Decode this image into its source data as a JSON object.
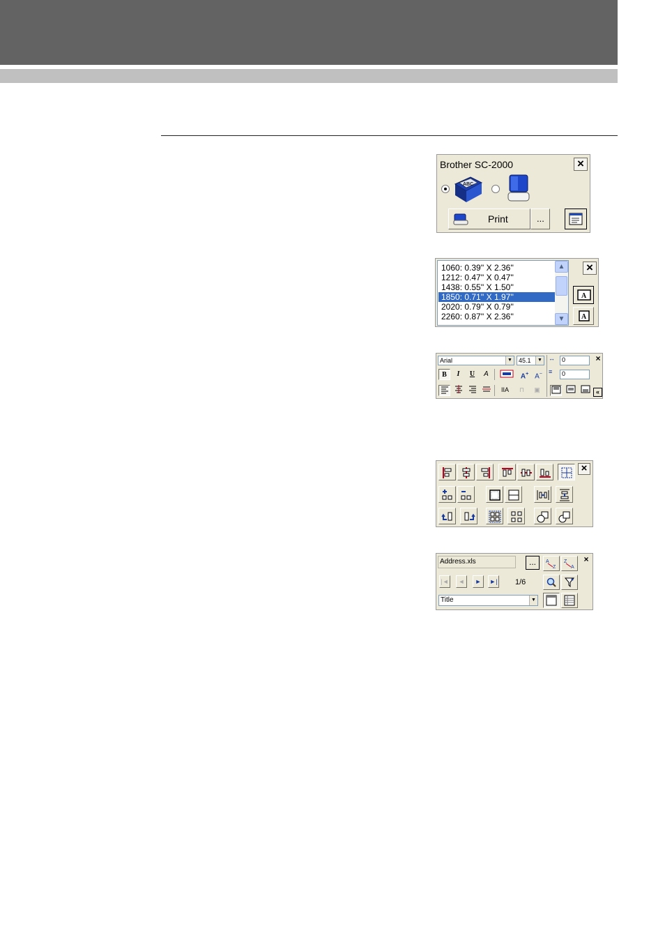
{
  "printer_panel": {
    "title": "Brother SC-2000",
    "print_label": "Print",
    "more_label": "..."
  },
  "tape_list": {
    "items": [
      "1060: 0.39'' X 2.36''",
      "1212: 0.47'' X 0.47''",
      "1438: 0.55'' X 1.50''",
      "1850: 0.71'' X 1.97''",
      "2020: 0.79'' X 0.79''",
      "2260: 0.87'' X 2.36''"
    ],
    "selected_index": 3
  },
  "text_toolbar": {
    "font": "Arial",
    "size": "45.1",
    "char_spacing": "0",
    "line_spacing": "0",
    "bold": "B",
    "italic": "I",
    "underline": "U"
  },
  "database_toolbar": {
    "file": "Address.xls",
    "browse_label": "...",
    "record": "1/6",
    "field": "Title"
  },
  "colors": {
    "header_dark": "#636363",
    "header_light": "#c0c0c0",
    "selection": "#316ac5",
    "panel_bg": "#ece9d8"
  }
}
